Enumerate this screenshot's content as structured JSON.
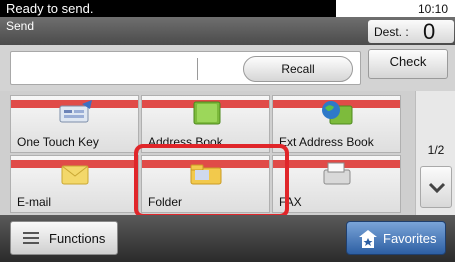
{
  "status": {
    "message": "Ready to send.",
    "time": "10:10"
  },
  "header": {
    "title": "Send",
    "dest_label": "Dest. :",
    "dest_count": "0"
  },
  "toolbar": {
    "recall_label": "Recall",
    "check_label": "Check"
  },
  "tiles": [
    {
      "label": "One Touch Key",
      "icon": "one-touch-key-icon"
    },
    {
      "label": "Address Book",
      "icon": "address-book-icon"
    },
    {
      "label": "Ext Address Book",
      "icon": "ext-address-book-icon"
    },
    {
      "label": "E-mail",
      "icon": "email-icon"
    },
    {
      "label": "Folder",
      "icon": "folder-icon"
    },
    {
      "label": "FAX",
      "icon": "fax-icon"
    }
  ],
  "pager": {
    "page": "1/2"
  },
  "bottom": {
    "functions_label": "Functions",
    "favorites_label": "Favorites"
  },
  "colors": {
    "accent_red": "#e0262a",
    "tile_band": "#e04b48",
    "favorites_blue": "#2d5fa3"
  }
}
